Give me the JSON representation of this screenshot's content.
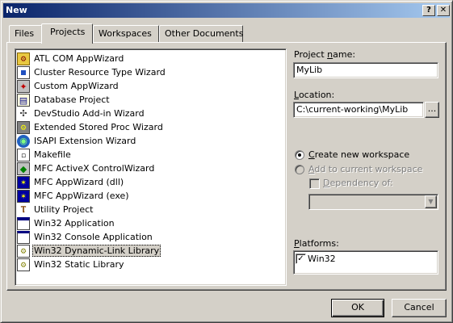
{
  "window": {
    "title": "New",
    "help_glyph": "?",
    "close_glyph": "✕"
  },
  "tabs": [
    {
      "label": "Files",
      "active": false
    },
    {
      "label": "Projects",
      "active": true
    },
    {
      "label": "Workspaces",
      "active": false
    },
    {
      "label": "Other Documents",
      "active": false
    }
  ],
  "project_types": [
    {
      "label": "ATL COM AppWizard",
      "icon": "atl-icon",
      "selected": false
    },
    {
      "label": "Cluster Resource Type Wizard",
      "icon": "cluster-icon",
      "selected": false
    },
    {
      "label": "Custom AppWizard",
      "icon": "custom-wizard-icon",
      "selected": false
    },
    {
      "label": "Database Project",
      "icon": "database-icon",
      "selected": false
    },
    {
      "label": "DevStudio Add-in Wizard",
      "icon": "addin-icon",
      "selected": false
    },
    {
      "label": "Extended Stored Proc Wizard",
      "icon": "stored-proc-icon",
      "selected": false
    },
    {
      "label": "ISAPI Extension Wizard",
      "icon": "isapi-icon",
      "selected": false
    },
    {
      "label": "Makefile",
      "icon": "makefile-icon",
      "selected": false
    },
    {
      "label": "MFC ActiveX ControlWizard",
      "icon": "activex-icon",
      "selected": false
    },
    {
      "label": "MFC AppWizard (dll)",
      "icon": "mfc-dll-icon",
      "selected": false
    },
    {
      "label": "MFC AppWizard (exe)",
      "icon": "mfc-exe-icon",
      "selected": false
    },
    {
      "label": "Utility Project",
      "icon": "utility-icon",
      "selected": false
    },
    {
      "label": "Win32 Application",
      "icon": "win32-app-icon",
      "selected": false
    },
    {
      "label": "Win32 Console Application",
      "icon": "console-icon",
      "selected": false
    },
    {
      "label": "Win32 Dynamic-Link Library",
      "icon": "dll-icon",
      "selected": true
    },
    {
      "label": "Win32 Static Library",
      "icon": "static-lib-icon",
      "selected": false
    }
  ],
  "project_name": {
    "label_pre": "Project ",
    "label_key": "n",
    "label_post": "ame:",
    "value": "MyLib"
  },
  "location": {
    "label_key": "L",
    "label_post": "ocation:",
    "value": "C:\\current-working\\MyLib",
    "browse_label": "..."
  },
  "workspace_options": {
    "create_new": {
      "label_key": "C",
      "label_post": "reate new workspace",
      "checked": true
    },
    "add_current": {
      "label_key": "A",
      "label_post": "dd to current workspace",
      "checked": false,
      "enabled": false
    },
    "dependency": {
      "label_key": "D",
      "label_post": "ependency of:",
      "checked": false,
      "enabled": false
    },
    "dependency_dropdown_value": ""
  },
  "platforms": {
    "label_key": "P",
    "label_post": "latforms:",
    "items": [
      {
        "label": "Win32",
        "checked": true
      }
    ]
  },
  "buttons": {
    "ok": "OK",
    "cancel": "Cancel"
  }
}
